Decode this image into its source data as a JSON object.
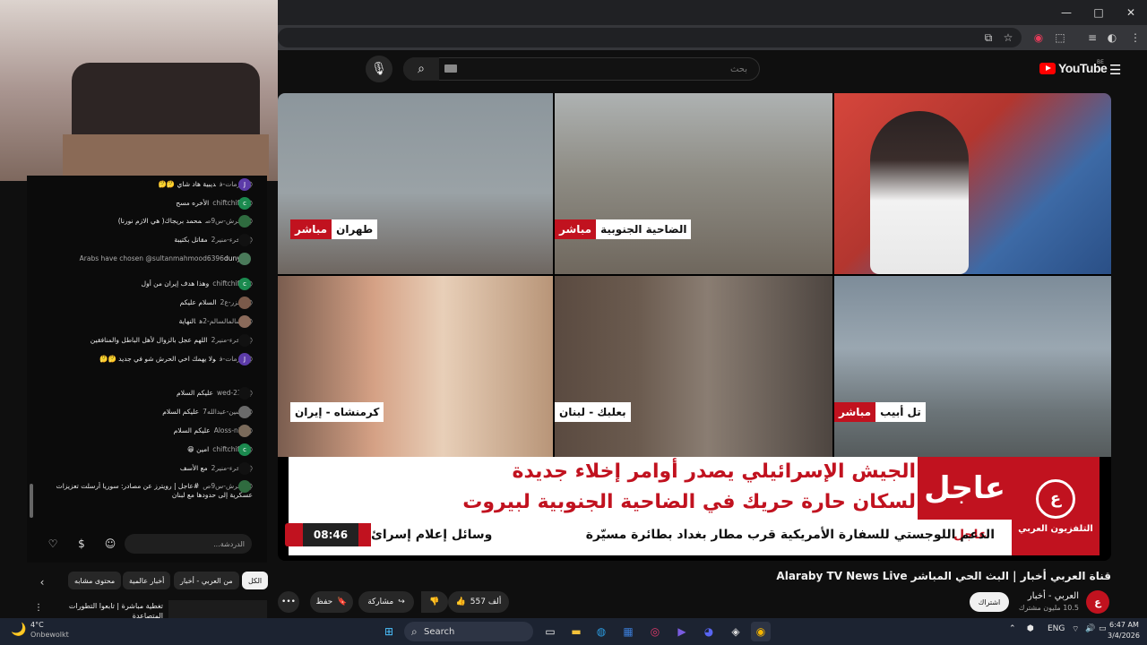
{
  "browser": {
    "window_controls": [
      "—",
      "□",
      "✕"
    ],
    "toolbar_icons": [
      "cast-icon",
      "star-icon",
      "extension-icon",
      "puzzle-icon",
      "media-icon",
      "profile-icon",
      "menu-icon"
    ]
  },
  "youtube": {
    "search_placeholder": "بحث",
    "logo_text": "YouTube",
    "region": "BE"
  },
  "video": {
    "tiles": [
      {
        "place": "طهران",
        "live": "مباشر"
      },
      {
        "place": "الضاحية الجنوبية",
        "live": "مباشر"
      },
      {
        "place": "",
        "live": ""
      },
      {
        "place": "كرمنشاه - إيران",
        "live": ""
      },
      {
        "place": "بعلبك - لبنان",
        "live": ""
      },
      {
        "place": "تل أبيب",
        "live": "مباشر"
      }
    ],
    "breaking_word": "عاجل",
    "headline_line1": "الجيش الإسرائيلي يصدر أوامر إخلاء جديدة",
    "headline_line2": "لسكان حارة حريك في الضاحية الجنوبية لبيروت",
    "ticker_label": "عاجل",
    "ticker_text": "الدعم اللوجستي للسفارة الأمريكية قرب مطار بغداد بطائرة مسيّرة",
    "ticker_end": "وسائل إعلام إسرائ",
    "clock": "08:46",
    "channel_logo_name": "التلفزيون العربي"
  },
  "meta": {
    "title": "قناة العربي أخبار | البث الحي المباشر Alaraby TV News Live",
    "channel_name": "العربي - أخبار",
    "subscribers": "10.5 مليون مشترك",
    "subscribe_label": "اشتراك",
    "likes": "557 ألف",
    "share_label": "مشاركة",
    "save_label": "حفظ",
    "more_label": "•••"
  },
  "chat": {
    "messages": [
      {
        "user": "@مازمات-ف",
        "text": "ديبية هاد شاي 🤔🤔",
        "avatar": "J",
        "color": "#5c3ba8"
      },
      {
        "user": "@chiftchifty",
        "text": "الأخره مسح",
        "avatar": "c",
        "color": "#1b8a4f"
      },
      {
        "user": "@الحرش-س9ص",
        "text": "محمد بريجاك( هي الازم نورنا)",
        "avatar": "",
        "color": "#2f6b3f"
      },
      {
        "user": "@الاخرء-منير2",
        "text": "مقاتل بكتيبة",
        "avatar": "",
        "color": "#111111"
      },
      {
        "user": "Arabs have chosen @sultanmahmood6396",
        "text": "dunyah",
        "avatar": "",
        "color": "#4a7a5a"
      },
      {
        "user": "@chiftchifty",
        "text": "وهذا هدف إيران من أول",
        "avatar": "c",
        "color": "#1b8a4f"
      },
      {
        "user": "@الحزر-ع2",
        "text": "السلام عليكم",
        "avatar": "",
        "color": "#7a5a4a"
      },
      {
        "user": "@السالمالسالم-2ه",
        "text": "النهاية",
        "avatar": "",
        "color": "#8a6a5a"
      },
      {
        "user": "@الاخرء-منير2",
        "text": "اللهم عجل بالزوال لأهل الباطل والمنافقين",
        "avatar": "",
        "color": "#111111"
      },
      {
        "user": "@مازمات-ف",
        "text": "ولا يهمك اخي الحرش شو في جديد 🤔🤔",
        "avatar": "J",
        "color": "#5c3ba8"
      },
      {
        "user": "@wed-221",
        "text": "عليكم السلام",
        "avatar": "",
        "color": "#111111"
      },
      {
        "user": "@حسين-عبدالله7",
        "text": "عليكم السلام",
        "avatar": "",
        "color": "#6a6a6a"
      },
      {
        "user": "@Aloss-n5z",
        "text": "عليكم السلام",
        "avatar": "",
        "color": "#7a6a5a"
      },
      {
        "user": "@chiftchifty",
        "text": "امين 😁",
        "avatar": "c",
        "color": "#1b8a4f"
      },
      {
        "user": "@الاخرء-منير2",
        "text": "مع الأسف",
        "avatar": "",
        "color": "#111111"
      },
      {
        "user": "@الحرش-س9ص",
        "text": "#عاجل | رويترز عن مصادر: سوريا أرسلت تعزيزات عسكرية إلى حدودها مع لبنان",
        "avatar": "",
        "color": "#2f6b3f"
      }
    ],
    "input_placeholder": "الدردشة...",
    "chips": [
      "الكل",
      "من العربي - أخبار",
      "أخبار عالمية",
      "محتوى مشابه"
    ],
    "related_title": "تغطية مباشرة | تابعوا التطورات المتصاعدة"
  },
  "taskbar": {
    "weather_temp": "4°C",
    "weather_desc": "Onbewolkt",
    "search_label": "Search",
    "lang": "ENG",
    "time": "6:47 AM",
    "date": "3/4/2026"
  }
}
